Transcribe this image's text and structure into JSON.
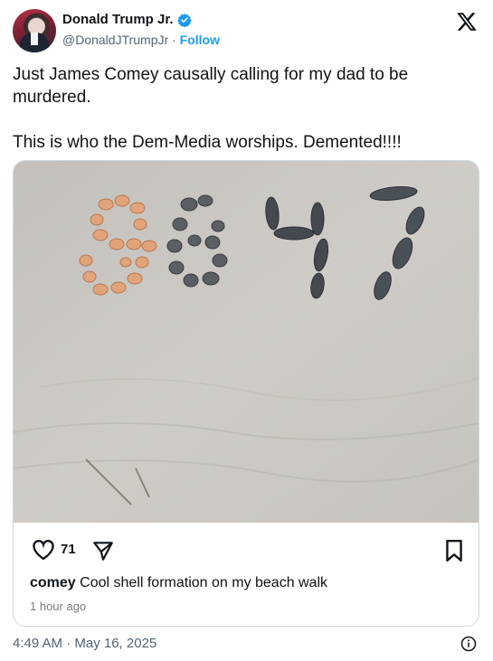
{
  "author": {
    "name": "Donald Trump Jr.",
    "handle": "@DonaldJTrumpJr",
    "separator": " · ",
    "follow_label": "Follow",
    "verified_color": "#1d9bf0"
  },
  "tweet": {
    "text": "Just James Comey causally calling for my dad to be murdered.\n\nThis is who the Dem-Media worships. Demented!!!!"
  },
  "embedded_post": {
    "photo_description_icon": "beach-shell-photo",
    "like_count": "71",
    "caption_user": "comey",
    "caption_text": " Cool shell formation on my beach walk",
    "time_ago": "1 hour ago"
  },
  "footer": {
    "timestamp": "4:49 AM · May 16, 2025",
    "info_icon": "info-icon"
  },
  "colors": {
    "link": "#1d9bf0",
    "muted": "#536471",
    "border": "#cfd9de",
    "sand": "#c9c6c1"
  }
}
